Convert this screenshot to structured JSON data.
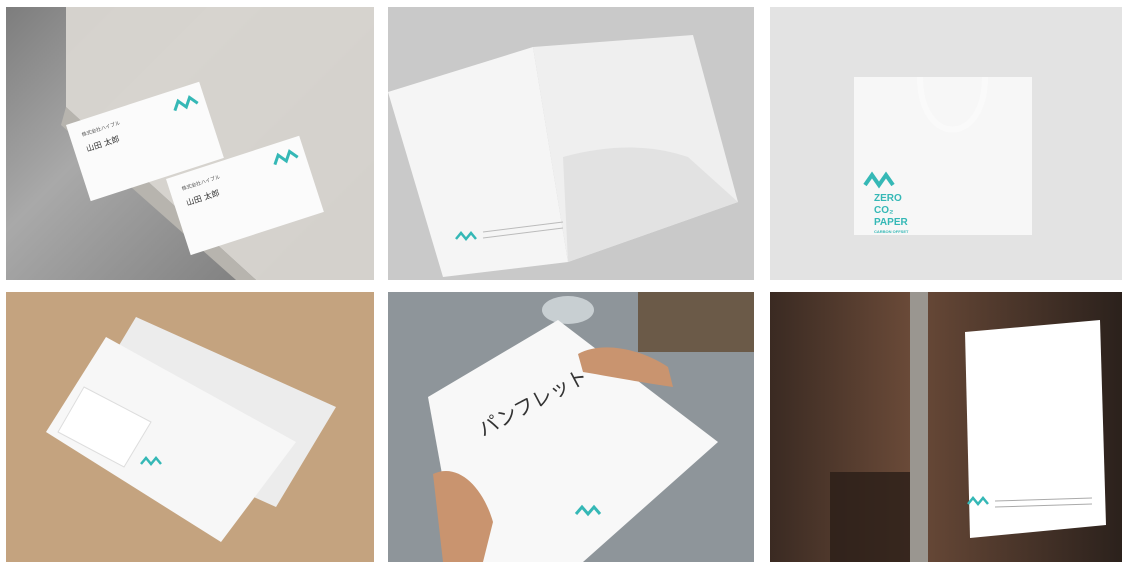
{
  "tiles": [
    {
      "name": "business-cards",
      "card_front": {
        "company": "株式会社ハイブル",
        "person": "山田 太郎"
      },
      "card_back": {
        "company": "株式会社ハイブル",
        "person": "山田 太郎"
      }
    },
    {
      "name": "folder"
    },
    {
      "name": "shopping-bag",
      "logo": {
        "line1": "ZERO",
        "line2": "CO₂",
        "line3": "PAPER",
        "line4": "CARBON OFFSET"
      }
    },
    {
      "name": "envelope"
    },
    {
      "name": "pamphlet",
      "title": "パンフレット"
    },
    {
      "name": "poster-in-window"
    }
  ],
  "colors": {
    "brand_teal": "#35b8b6",
    "paper": "#f7f7f5"
  }
}
